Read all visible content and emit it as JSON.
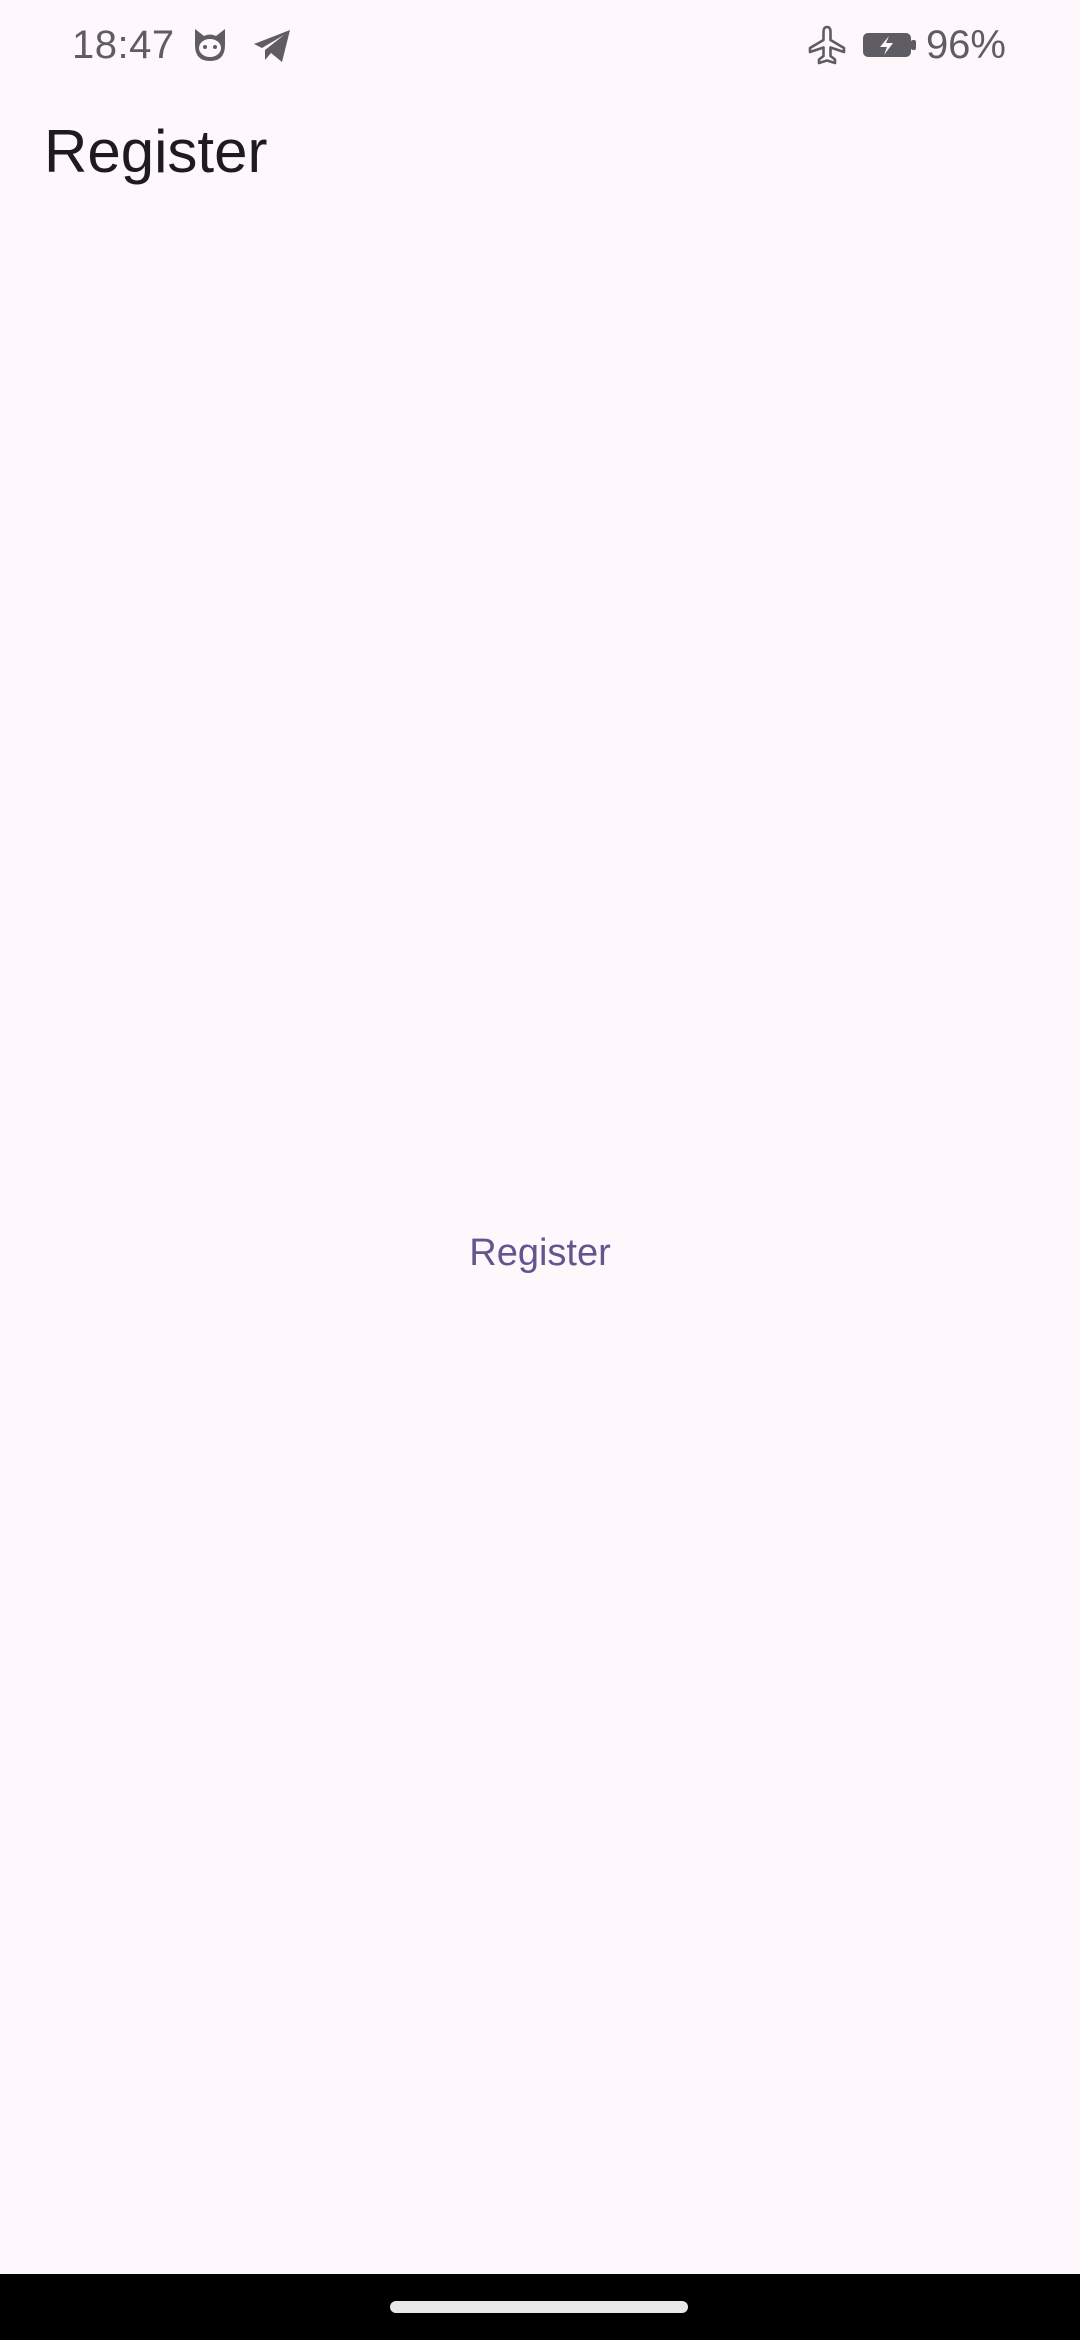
{
  "status_bar": {
    "time": "18:47",
    "battery_percent": "96%",
    "icons": [
      "cat-face-icon",
      "telegram-icon",
      "airplane-mode-icon",
      "battery-charging-icon"
    ],
    "battery_level": 0.96
  },
  "app_bar": {
    "title": "Register"
  },
  "main": {
    "register_button_label": "Register"
  },
  "colors": {
    "background": "#fef7fc",
    "accent": "#65558f",
    "text_primary": "#1d1b20",
    "status_icons": "#5f5d63",
    "nav_bar": "#000000"
  }
}
